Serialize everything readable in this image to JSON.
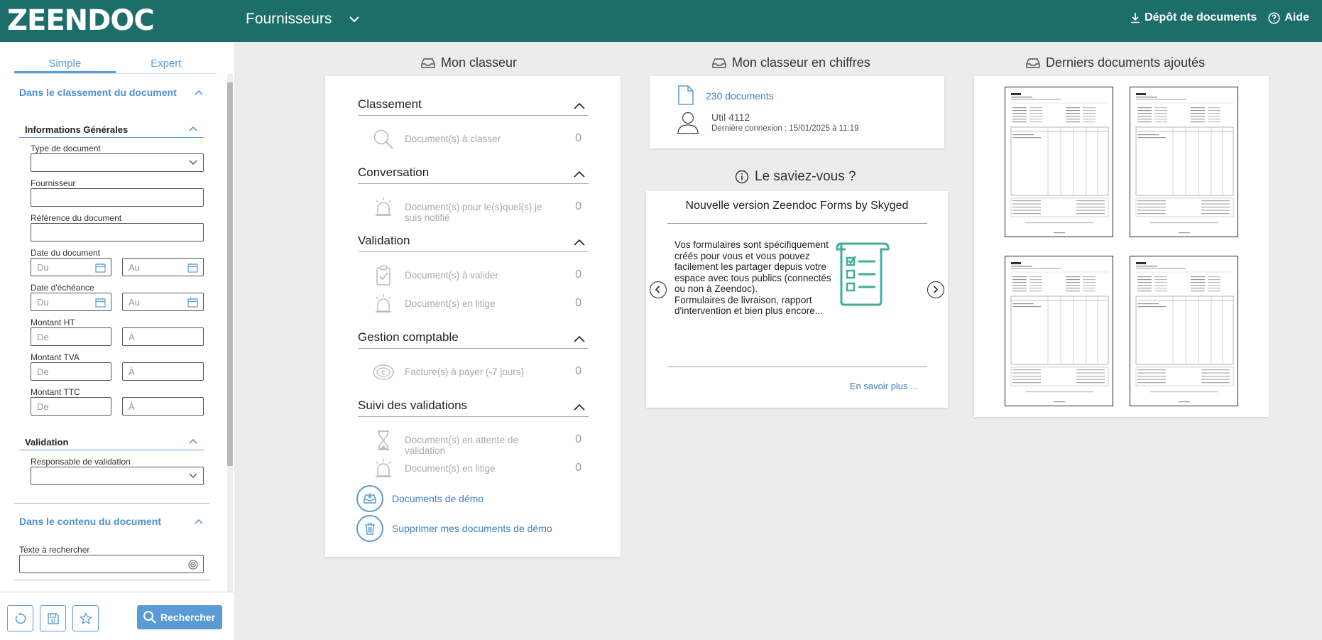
{
  "topbar": {
    "logo": "ZEENDOC",
    "module": "Fournisseurs",
    "depot_label": "Dépôt de documents",
    "aide_label": "Aide"
  },
  "sidebar": {
    "tabs": [
      "Simple",
      "Expert"
    ],
    "section_classement": "Dans le classement du document",
    "group_info": "Informations Générales",
    "fields": {
      "type_document": "Type de document",
      "fournisseur": "Fournisseur",
      "reference": "Référence du document",
      "date_document": "Date du document",
      "date_echeance": "Date d'échéance",
      "montant_ht": "Montant HT",
      "montant_tva": "Montant TVA",
      "montant_ttc": "Montant TTC"
    },
    "placeholders": {
      "du": "Du",
      "au": "Au",
      "de": "De",
      "a": "À"
    },
    "group_validation": "Validation",
    "responsable_validation": "Responsable de validation",
    "section_contenu": "Dans le contenu du document",
    "texte_rechercher": "Texte à rechercher",
    "search_button": "Rechercher"
  },
  "classeur": {
    "title": "Mon classeur",
    "sections": [
      {
        "title": "Classement",
        "rows": [
          {
            "icon": "magnifier-icon",
            "label": "Document(s) à classer",
            "count": "0"
          }
        ]
      },
      {
        "title": "Conversation",
        "rows": [
          {
            "icon": "alarm-bell-icon",
            "label": "Document(s) pour le(s)quel(s) je suis notifié",
            "count": "0"
          }
        ]
      },
      {
        "title": "Validation",
        "rows": [
          {
            "icon": "clipboard-check-icon",
            "label": "Document(s) à valider",
            "count": "0"
          },
          {
            "icon": "alarm-bell-icon",
            "label": "Document(s) en litige",
            "count": "0"
          }
        ]
      },
      {
        "title": "Gestion comptable",
        "rows": [
          {
            "icon": "coin-icon",
            "label": "Facture(s) à payer (-7 jours)",
            "count": "0"
          }
        ]
      },
      {
        "title": "Suivi des validations",
        "rows": [
          {
            "icon": "hourglass-icon",
            "label": "Document(s) en attente de validation",
            "count": "0"
          },
          {
            "icon": "alarm-bell-icon",
            "label": "Document(s) en litige",
            "count": "0"
          }
        ]
      }
    ],
    "demo_link": "Documents de démo",
    "delete_demo_link": "Supprimer mes documents de démo"
  },
  "chiffres": {
    "title": "Mon classeur en chiffres",
    "documents": "230 documents",
    "user": "Util 4112",
    "last_login": "Dernière connexion : 15/01/2025 à 11:19"
  },
  "saviez": {
    "title": "Le saviez-vous ?",
    "announcement_title": "Nouvelle version Zeendoc Forms by Skyged",
    "announcement_text": "Vos formulaires sont spécifiquement créés pour vous et vous pouvez facilement les partager depuis votre espace avec tous publics (connectés ou non à Zeendoc).\nFormulaires de livraison, rapport d'intervention et bien plus encore...",
    "link": "En savoir plus ..."
  },
  "derniers": {
    "title": "Derniers documents ajoutés"
  },
  "colors": {
    "topbar": "#1d6e6a",
    "accent": "#5a9bd4",
    "link": "#3f7fc0",
    "forms_icon": "#3fae9a"
  }
}
